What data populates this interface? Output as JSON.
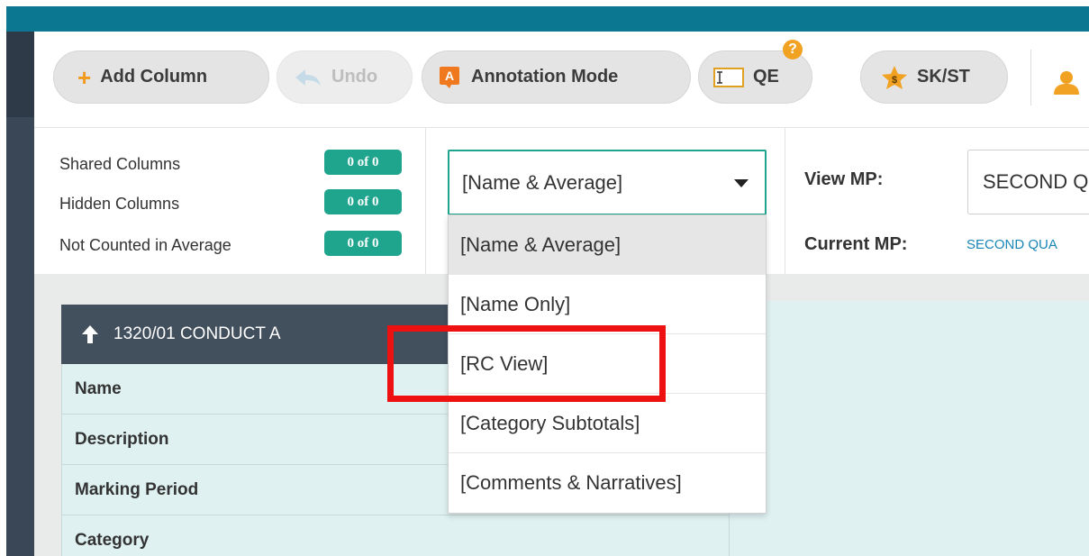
{
  "toolbar": {
    "add_column": "Add Column",
    "undo": "Undo",
    "annotation_mode": "Annotation Mode",
    "qe": "QE",
    "help": "?",
    "sk_st": "SK/ST"
  },
  "stats": [
    {
      "label": "Shared Columns",
      "badge": "0 of 0"
    },
    {
      "label": "Hidden Columns",
      "badge": "0 of 0"
    },
    {
      "label": "Not Counted in Average",
      "badge": "0 of 0"
    }
  ],
  "view_select": {
    "value": "[Name & Average]",
    "options": [
      "[Name & Average]",
      "[Name Only]",
      "[RC View]",
      "[Category Subtotals]",
      "[Comments & Narratives]"
    ]
  },
  "view_mp": {
    "label": "View MP:",
    "value": "SECOND Q"
  },
  "current_mp": {
    "label": "Current MP:",
    "value": "SECOND QUA"
  },
  "table": {
    "title": "1320/01 CONDUCT A",
    "rows": [
      "Name",
      "Description",
      "Marking Period",
      "Category"
    ]
  },
  "colors": {
    "top_bar": "#0b7790",
    "badge": "#1fa58d",
    "highlight": "#ee1111",
    "table_header": "#424f5d",
    "row_bg": "#dff1f1"
  }
}
